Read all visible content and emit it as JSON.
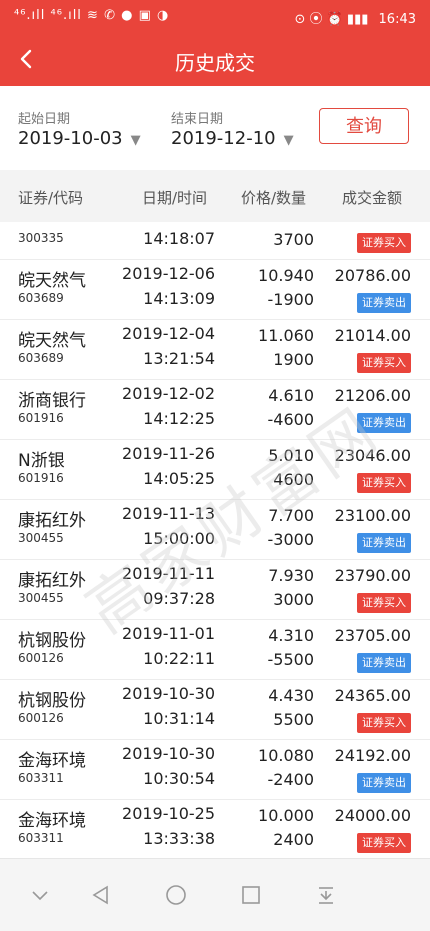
{
  "statusbar": {
    "left_icons": "⁴⁶.ıll ⁴⁶.ıll ≋ ✆ ● ▣ ◑",
    "right_icons": "⊙ ⦿ ⏰ ▮▮▮",
    "time": "16:43"
  },
  "header": {
    "title": "历史成交",
    "back_icon": "back-arrow-icon"
  },
  "filter": {
    "start_label": "起始日期",
    "start_value": "2019-10-03",
    "end_label": "结束日期",
    "end_value": "2019-12-10",
    "query_label": "查询"
  },
  "table": {
    "columns": [
      "证券/代码",
      "日期/时间",
      "价格/数量",
      "成交金额"
    ],
    "rows": [
      {
        "name": "",
        "code": "300335",
        "date": "",
        "time": "14:18:07",
        "price": "",
        "qty": "3700",
        "amount": "",
        "side": "证券买入",
        "type": "buy"
      },
      {
        "name": "皖天然气",
        "code": "603689",
        "date": "2019-12-06",
        "time": "14:13:09",
        "price": "10.940",
        "qty": "-1900",
        "amount": "20786.00",
        "side": "证券卖出",
        "type": "sell"
      },
      {
        "name": "皖天然气",
        "code": "603689",
        "date": "2019-12-04",
        "time": "13:21:54",
        "price": "11.060",
        "qty": "1900",
        "amount": "21014.00",
        "side": "证券买入",
        "type": "buy"
      },
      {
        "name": "浙商银行",
        "code": "601916",
        "date": "2019-12-02",
        "time": "14:12:25",
        "price": "4.610",
        "qty": "-4600",
        "amount": "21206.00",
        "side": "证券卖出",
        "type": "sell"
      },
      {
        "name": "N浙银",
        "code": "601916",
        "date": "2019-11-26",
        "time": "14:05:25",
        "price": "5.010",
        "qty": "4600",
        "amount": "23046.00",
        "side": "证券买入",
        "type": "buy"
      },
      {
        "name": "康拓红外",
        "code": "300455",
        "date": "2019-11-13",
        "time": "15:00:00",
        "price": "7.700",
        "qty": "-3000",
        "amount": "23100.00",
        "side": "证券卖出",
        "type": "sell"
      },
      {
        "name": "康拓红外",
        "code": "300455",
        "date": "2019-11-11",
        "time": "09:37:28",
        "price": "7.930",
        "qty": "3000",
        "amount": "23790.00",
        "side": "证券买入",
        "type": "buy"
      },
      {
        "name": "杭钢股份",
        "code": "600126",
        "date": "2019-11-01",
        "time": "10:22:11",
        "price": "4.310",
        "qty": "-5500",
        "amount": "23705.00",
        "side": "证券卖出",
        "type": "sell"
      },
      {
        "name": "杭钢股份",
        "code": "600126",
        "date": "2019-10-30",
        "time": "10:31:14",
        "price": "4.430",
        "qty": "5500",
        "amount": "24365.00",
        "side": "证券买入",
        "type": "buy"
      },
      {
        "name": "金海环境",
        "code": "603311",
        "date": "2019-10-30",
        "time": "10:30:54",
        "price": "10.080",
        "qty": "-2400",
        "amount": "24192.00",
        "side": "证券卖出",
        "type": "sell"
      },
      {
        "name": "金海环境",
        "code": "603311",
        "date": "2019-10-25",
        "time": "13:33:38",
        "price": "10.000",
        "qty": "2400",
        "amount": "24000.00",
        "side": "证券买入",
        "type": "buy"
      }
    ]
  },
  "watermark": "高家财富网",
  "colors": {
    "brand": "#e9443b",
    "buy": "#e9443b",
    "sell": "#3f8fe6"
  },
  "bottom_nav": [
    "collapse-icon",
    "back-triangle-icon",
    "home-circle-icon",
    "recent-square-icon",
    "notification-drawer-icon"
  ]
}
